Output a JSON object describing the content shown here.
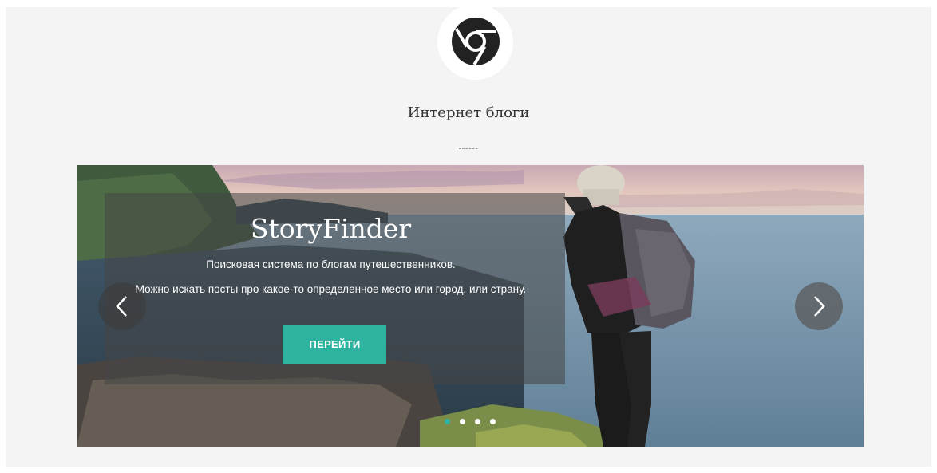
{
  "header": {
    "logo_icon": "browser-logo-icon",
    "title": "Интернет блоги",
    "separator": "------"
  },
  "slider": {
    "slide_title": "StoryFinder",
    "description_line1": "Поисковая система по блогам путешественников.",
    "description_line2": "Можно искать посты про какое-то определенное место или город, или страну.",
    "button_label": "ПЕРЕЙТИ",
    "prev_icon": "chevron-left-icon",
    "next_icon": "chevron-right-icon",
    "slide_count": 4,
    "active_slide": 1
  },
  "colors": {
    "accent": "#2fb3a1",
    "background": "#f4f4f4"
  }
}
